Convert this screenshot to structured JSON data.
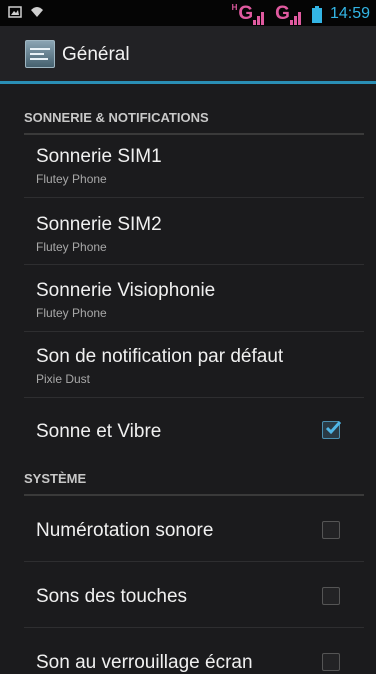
{
  "status_bar": {
    "network_label": "G",
    "tiny_label": "H",
    "time": "14:59"
  },
  "action_bar": {
    "title": "Général",
    "icon": "settings-app-icon"
  },
  "sections": [
    {
      "header": "SONNERIE & NOTIFICATIONS",
      "items": [
        {
          "title": "Sonnerie SIM1",
          "summary": "Flutey Phone"
        },
        {
          "title": "Sonnerie SIM2",
          "summary": "Flutey Phone"
        },
        {
          "title": "Sonnerie Visiophonie",
          "summary": "Flutey Phone"
        },
        {
          "title": "Son de notification par défaut",
          "summary": "Pixie Dust"
        },
        {
          "title": "Sonne et Vibre",
          "checked": true
        }
      ]
    },
    {
      "header": "SYSTÈME",
      "items": [
        {
          "title": "Numérotation sonore",
          "checked": false
        },
        {
          "title": "Sons des touches",
          "checked": false
        },
        {
          "title": "Son au verrouillage écran",
          "checked": false
        }
      ]
    }
  ],
  "colors": {
    "accent": "#33b5e5",
    "network": "#e05aa0",
    "background": "#1b1b1d"
  }
}
